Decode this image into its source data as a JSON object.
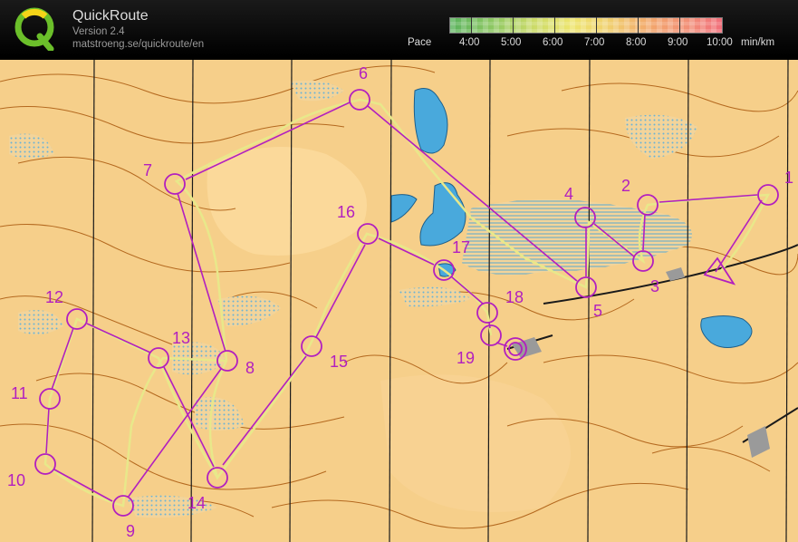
{
  "app": {
    "title": "QuickRoute",
    "version": "Version 2.4",
    "url": "matstroeng.se/quickroute/en"
  },
  "pace_scale": {
    "label": "Pace",
    "values": [
      "4:00",
      "5:00",
      "6:00",
      "7:00",
      "8:00",
      "9:00",
      "10:00"
    ],
    "unit": "min/km",
    "colors": {
      "fast": "#59b25c",
      "medium": "#eee56e",
      "slow": "#f16f7b"
    }
  },
  "map": {
    "course_color": "#b21fbf",
    "route_color": "#e8e88a",
    "controls": [
      "1",
      "2",
      "3",
      "4",
      "5",
      "6",
      "7",
      "8",
      "9",
      "10",
      "11",
      "12",
      "13",
      "14",
      "15",
      "16",
      "17",
      "18",
      "19"
    ]
  }
}
